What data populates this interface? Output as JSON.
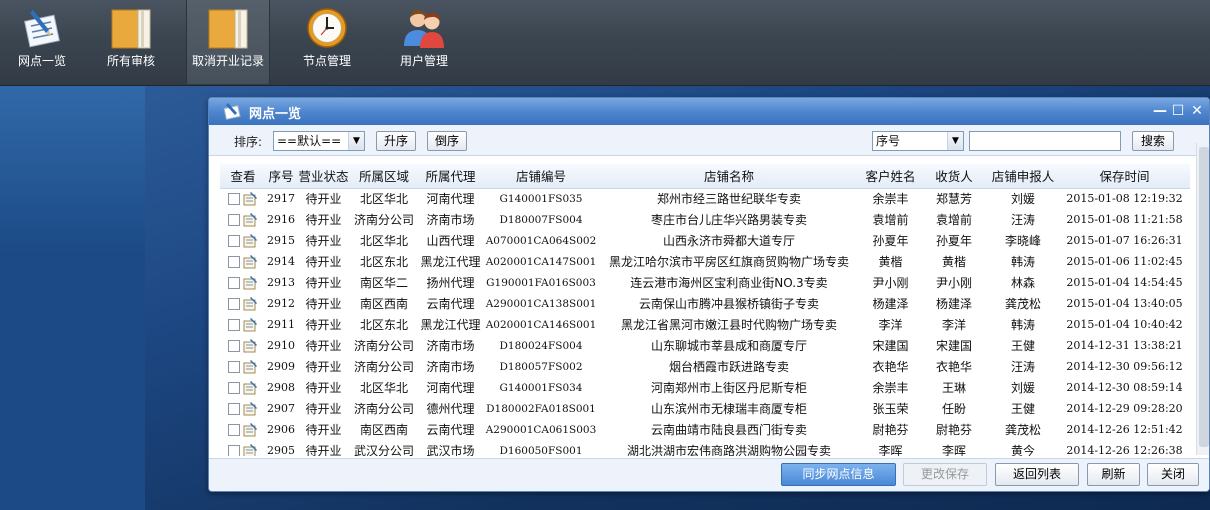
{
  "toolbar": {
    "items": [
      {
        "label": "网点一览",
        "icon": "list-pencil-icon"
      },
      {
        "label": "所有审核",
        "icon": "folder-icon"
      },
      {
        "label": "取消开业记录",
        "icon": "folder-icon"
      },
      {
        "label": "节点管理",
        "icon": "clock-icon"
      },
      {
        "label": "用户管理",
        "icon": "users-icon"
      }
    ],
    "active_index": 2
  },
  "window": {
    "title": "网点一览",
    "controls": {
      "minimize": "—",
      "maximize": "☐",
      "close": "✕"
    }
  },
  "filter": {
    "sort_label": "排序:",
    "sort_value": "==默认==",
    "asc_label": "升序",
    "desc_label": "倒序",
    "search_field_value": "序号",
    "search_text": "",
    "search_label": "搜索"
  },
  "table": {
    "columns": [
      "查看",
      "序号",
      "营业状态",
      "所属区域",
      "所属代理",
      "店铺编号",
      "店铺名称",
      "客户姓名",
      "收货人",
      "店铺申报人",
      "保存时间"
    ],
    "rows": [
      [
        "2917",
        "待开业",
        "北区华北",
        "河南代理",
        "G140001FS035",
        "郑州市经三路世纪联华专卖",
        "余崇丰",
        "郑慧芳",
        "刘媛",
        "2015-01-08 12:19:32"
      ],
      [
        "2916",
        "待开业",
        "济南分公司",
        "济南市场",
        "D180007FS004",
        "枣庄市台儿庄华兴路男装专卖",
        "袁增前",
        "袁增前",
        "汪涛",
        "2015-01-08 11:21:58"
      ],
      [
        "2915",
        "待开业",
        "北区华北",
        "山西代理",
        "A070001CA064S002",
        "山西永济市舜都大道专厅",
        "孙夏年",
        "孙夏年",
        "李晓峰",
        "2015-01-07 16:26:31"
      ],
      [
        "2914",
        "待开业",
        "北区东北",
        "黑龙江代理",
        "A020001CA147S001",
        "黑龙江哈尔滨市平房区红旗商贸购物广场专卖",
        "黄楷",
        "黄楷",
        "韩涛",
        "2015-01-06 11:02:45"
      ],
      [
        "2913",
        "待开业",
        "南区华二",
        "扬州代理",
        "G190001FA016S003",
        "连云港市海州区宝利商业街NO.3专卖",
        "尹小刚",
        "尹小刚",
        "林森",
        "2015-01-04 14:54:45"
      ],
      [
        "2912",
        "待开业",
        "南区西南",
        "云南代理",
        "A290001CA138S001",
        "云南保山市腾冲县猴桥镇街子专卖",
        "杨建泽",
        "杨建泽",
        "龚茂松",
        "2015-01-04 13:40:05"
      ],
      [
        "2911",
        "待开业",
        "北区东北",
        "黑龙江代理",
        "A020001CA146S001",
        "黑龙江省黑河市嫩江县时代购物广场专卖",
        "李洋",
        "李洋",
        "韩涛",
        "2015-01-04 10:40:42"
      ],
      [
        "2910",
        "待开业",
        "济南分公司",
        "济南市场",
        "D180024FS004",
        "山东聊城市莘县成和商厦专厅",
        "宋建国",
        "宋建国",
        "王健",
        "2014-12-31 13:38:21"
      ],
      [
        "2909",
        "待开业",
        "济南分公司",
        "济南市场",
        "D180057FS002",
        "烟台栖霞市跃进路专卖",
        "衣艳华",
        "衣艳华",
        "汪涛",
        "2014-12-30 09:56:12"
      ],
      [
        "2908",
        "待开业",
        "北区华北",
        "河南代理",
        "G140001FS034",
        "河南郑州市上街区丹尼斯专柜",
        "余崇丰",
        "王琳",
        "刘媛",
        "2014-12-30 08:59:14"
      ],
      [
        "2907",
        "待开业",
        "济南分公司",
        "德州代理",
        "D180002FA018S001",
        "山东滨州市无棣瑞丰商厦专柜",
        "张玉荣",
        "任盼",
        "王健",
        "2014-12-29 09:28:20"
      ],
      [
        "2906",
        "待开业",
        "南区西南",
        "云南代理",
        "A290001CA061S003",
        "云南曲靖市陆良县西门街专卖",
        "尉艳芬",
        "尉艳芬",
        "龚茂松",
        "2014-12-26 12:51:42"
      ],
      [
        "2905",
        "待开业",
        "武汉分公司",
        "武汉市场",
        "D160050FS001",
        "湖北洪湖市宏伟商路洪湖购物公园专卖",
        "李晖",
        "李晖",
        "黄今",
        "2014-12-26 12:26:38"
      ]
    ]
  },
  "footer": {
    "sync": "同步网点信息",
    "save": "更改保存",
    "back": "返回列表",
    "refresh": "刷新",
    "close": "关闭"
  }
}
